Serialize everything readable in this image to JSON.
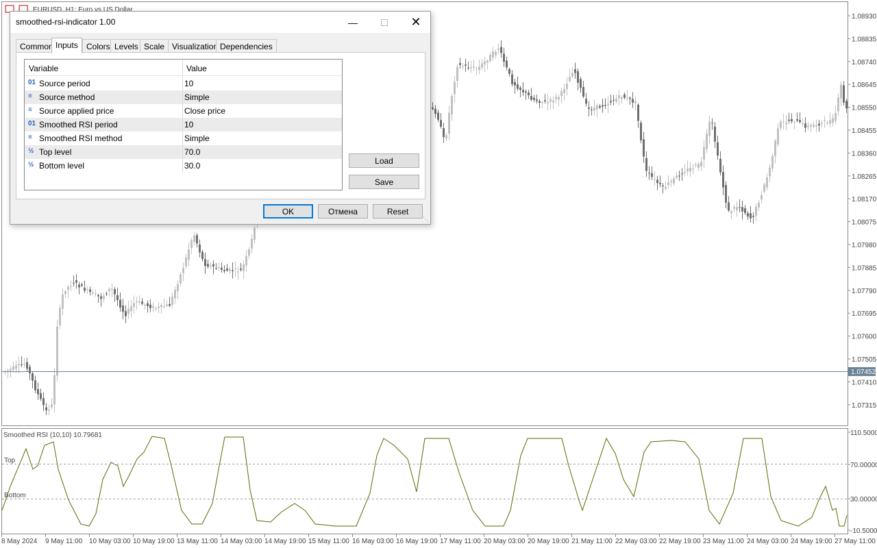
{
  "window": {
    "chart_title": "EURUSD, H1: Euro vs US Dollar",
    "indicator_label": "Smoothed RSI (10,10) 10.79681",
    "current_price": "1.07452",
    "top_label": "Top",
    "bottom_label": "Bottom"
  },
  "price_axis": [
    "1.08930",
    "1.08835",
    "1.08740",
    "1.08645",
    "1.08550",
    "1.08455",
    "1.08360",
    "1.08265",
    "1.08170",
    "1.08075",
    "1.07980",
    "1.07885",
    "1.07790",
    "1.07695",
    "1.07600",
    "1.07505",
    "1.07410",
    "1.07315"
  ],
  "indicator_axis": [
    "110.5000",
    "70.00000",
    "30.00000",
    "-10.5000"
  ],
  "time_axis": [
    "8 May 2024",
    "9 May 11:00",
    "10 May 03:00",
    "10 May 19:00",
    "13 May 11:00",
    "14 May 03:00",
    "14 May 19:00",
    "15 May 11:00",
    "16 May 03:00",
    "16 May 19:00",
    "17 May 11:00",
    "20 May 03:00",
    "20 May 19:00",
    "21 May 11:00",
    "22 May 03:00",
    "22 May 19:00",
    "23 May 11:00",
    "24 May 03:00",
    "24 May 19:00",
    "27 May 11:00"
  ],
  "dialog": {
    "title": "smoothed-rsi-indicator 1.00",
    "tabs": [
      "Common",
      "Inputs",
      "Colors",
      "Levels",
      "Scale",
      "Visualization",
      "Dependencies"
    ],
    "active_tab": "Inputs",
    "grid_header": {
      "variable": "Variable",
      "value": "Value"
    },
    "rows": [
      {
        "icon": "int-type-icon",
        "name": "Source period",
        "value": "10"
      },
      {
        "icon": "enum-type-icon",
        "name": "Source method",
        "value": "Simple"
      },
      {
        "icon": "enum-type-icon",
        "name": "Source applied price",
        "value": "Close price"
      },
      {
        "icon": "int-type-icon",
        "name": "Smoothed RSI period",
        "value": "10"
      },
      {
        "icon": "enum-type-icon",
        "name": "Smoothed RSI method",
        "value": "Simple"
      },
      {
        "icon": "double-type-icon",
        "name": "Top level",
        "value": "70.0"
      },
      {
        "icon": "double-type-icon",
        "name": "Bottom level",
        "value": "30.0"
      }
    ],
    "load_label": "Load",
    "save_label": "Save",
    "ok_label": "OK",
    "cancel_label": "Отмена",
    "reset_label": "Reset",
    "accent_color": "#0078d7"
  },
  "colors": {
    "rsi_line": "#556b00",
    "candle_up": "#c0c0c0",
    "candle_down": "#6e6e6e",
    "price_line": "#6c8498"
  }
}
